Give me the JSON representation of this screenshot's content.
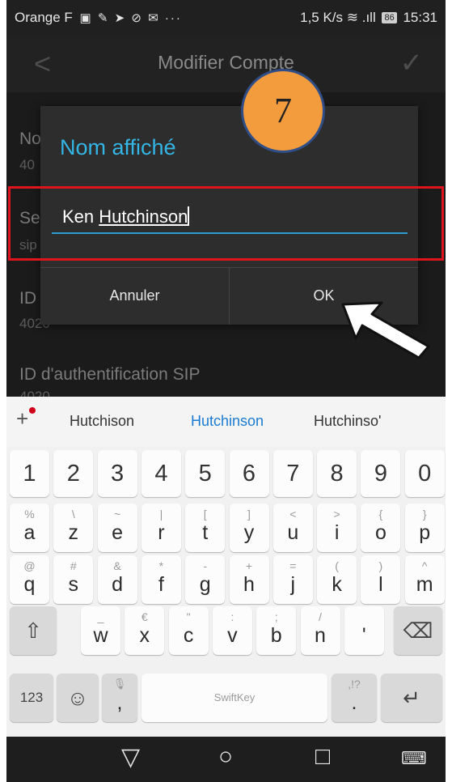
{
  "status_bar": {
    "carrier": "Orange F",
    "speed": "1,5 K/s",
    "battery": "86",
    "time": "15:31"
  },
  "app_bar": {
    "title": "Modifier Compte"
  },
  "background_fields": [
    {
      "label": "No",
      "value": "40"
    },
    {
      "label": "Se",
      "value": "sip"
    },
    {
      "label": "ID",
      "value": "4020"
    },
    {
      "label": "ID d'authentification SIP",
      "value": "4020"
    }
  ],
  "dialog": {
    "title": "Nom affiché",
    "input_value_first": "Ken ",
    "input_value_second": "Hutchinson",
    "cancel_label": "Annuler",
    "ok_label": "OK"
  },
  "annotation": {
    "step_number": "7",
    "highlight_color": "#e0141c",
    "badge_color": "#f29c3e"
  },
  "keyboard": {
    "suggestions": [
      "Hutchison",
      "Hutchinson",
      "Hutchinso'"
    ],
    "number_row": [
      "1",
      "2",
      "3",
      "4",
      "5",
      "6",
      "7",
      "8",
      "9",
      "0"
    ],
    "row1": [
      {
        "main": "a",
        "sub": "%"
      },
      {
        "main": "z",
        "sub": "\\"
      },
      {
        "main": "e",
        "sub": "~"
      },
      {
        "main": "r",
        "sub": "|"
      },
      {
        "main": "t",
        "sub": "["
      },
      {
        "main": "y",
        "sub": "]"
      },
      {
        "main": "u",
        "sub": "<"
      },
      {
        "main": "i",
        "sub": ">"
      },
      {
        "main": "o",
        "sub": "{"
      },
      {
        "main": "p",
        "sub": "}"
      }
    ],
    "row2": [
      {
        "main": "q",
        "sub": "@"
      },
      {
        "main": "s",
        "sub": "#"
      },
      {
        "main": "d",
        "sub": "&"
      },
      {
        "main": "f",
        "sub": "*"
      },
      {
        "main": "g",
        "sub": "-"
      },
      {
        "main": "h",
        "sub": "+"
      },
      {
        "main": "j",
        "sub": "="
      },
      {
        "main": "k",
        "sub": "("
      },
      {
        "main": "l",
        "sub": ")"
      },
      {
        "main": "m",
        "sub": "^"
      }
    ],
    "row3": [
      {
        "main": "w",
        "sub": "_"
      },
      {
        "main": "x",
        "sub": "€"
      },
      {
        "main": "c",
        "sub": "\""
      },
      {
        "main": "v",
        "sub": ":"
      },
      {
        "main": "b",
        "sub": ";"
      },
      {
        "main": "n",
        "sub": "/"
      },
      {
        "main": "'",
        "sub": ""
      }
    ],
    "numbers_key": "123",
    "comma": ",",
    "period": ".",
    "period_alt": ",!?",
    "space_brand": "SwiftKey",
    "mic_hint": "🎙"
  },
  "icons": {
    "shift": "shift-icon",
    "backspace": "backspace-icon",
    "emoji": "emoji-icon",
    "enter": "enter-icon",
    "back_nav": "back-triangle-icon",
    "home_nav": "home-circle-icon",
    "recents_nav": "recents-square-icon",
    "keyboard_nav": "keyboard-icon"
  }
}
